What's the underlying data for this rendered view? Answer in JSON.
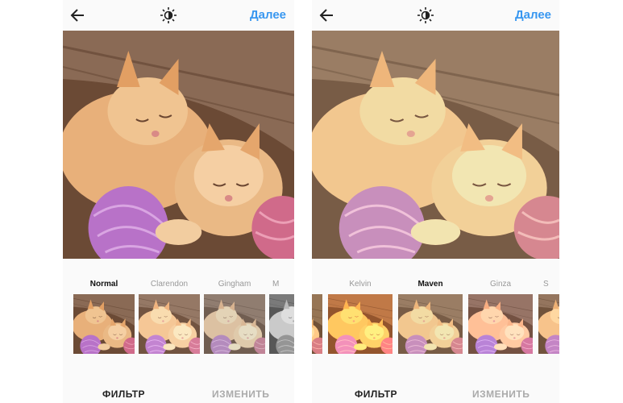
{
  "left_screen": {
    "header": {
      "back_icon": "arrow-left-icon",
      "brightness_icon": "lux-icon",
      "next_label": "Далее"
    },
    "photo": {
      "subject": "kittens-with-yarn"
    },
    "filters": [
      {
        "label": "Normal",
        "active": true
      },
      {
        "label": "Clarendon",
        "active": false
      },
      {
        "label": "Gingham",
        "active": false
      },
      {
        "label": "M",
        "active": false
      }
    ],
    "tabs": {
      "filter_label": "ФИЛЬТР",
      "edit_label": "ИЗМЕНИТЬ"
    }
  },
  "right_screen": {
    "header": {
      "back_icon": "arrow-left-icon",
      "brightness_icon": "lux-icon",
      "next_label": "Далее"
    },
    "photo": {
      "subject": "kittens-with-yarn",
      "filter_applied": "Maven"
    },
    "filters": [
      {
        "label": "",
        "active": false
      },
      {
        "label": "Kelvin",
        "active": false
      },
      {
        "label": "Maven",
        "active": true
      },
      {
        "label": "Ginza",
        "active": false
      },
      {
        "label": "S",
        "active": false
      }
    ],
    "tabs": {
      "filter_label": "ФИЛЬТР",
      "edit_label": "ИЗМЕНИТЬ"
    }
  },
  "colors": {
    "accent": "#3897f0",
    "background": "#fafafa"
  }
}
